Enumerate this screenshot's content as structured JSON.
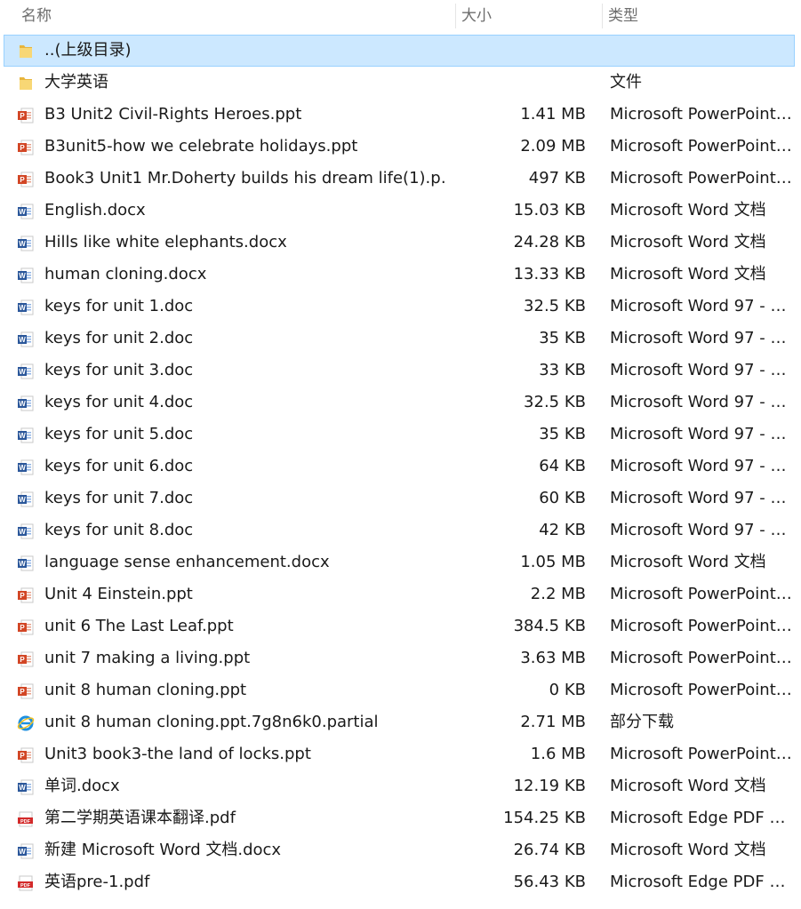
{
  "columns": {
    "name": "名称",
    "size": "大小",
    "type": "类型"
  },
  "colors": {
    "selected_bg": "#cce8ff",
    "selected_border": "#99d1ff",
    "header_text": "#6d6d6d"
  },
  "files": [
    {
      "name": "..(上级目录)",
      "size": "",
      "type": "",
      "icon": "folder-icon",
      "selected": true
    },
    {
      "name": "大学英语",
      "size": "",
      "type": "文件",
      "icon": "folder-icon"
    },
    {
      "name": "B3 Unit2 Civil-Rights Heroes.ppt",
      "size": "1.41 MB",
      "type": "Microsoft PowerPoint…",
      "icon": "ppt-icon"
    },
    {
      "name": "B3unit5-how we celebrate holidays.ppt",
      "size": "2.09 MB",
      "type": "Microsoft PowerPoint…",
      "icon": "ppt-icon"
    },
    {
      "name": "Book3 Unit1 Mr.Doherty builds his dream life(1).p…",
      "size": "497 KB",
      "type": "Microsoft PowerPoint…",
      "icon": "ppt-icon"
    },
    {
      "name": "English.docx",
      "size": "15.03 KB",
      "type": "Microsoft Word 文档",
      "icon": "word-icon"
    },
    {
      "name": "Hills like white elephants.docx",
      "size": "24.28 KB",
      "type": "Microsoft Word 文档",
      "icon": "word-icon"
    },
    {
      "name": "human cloning.docx",
      "size": "13.33 KB",
      "type": "Microsoft Word 文档",
      "icon": "word-icon"
    },
    {
      "name": "keys for unit 1.doc",
      "size": "32.5 KB",
      "type": "Microsoft Word 97 - …",
      "icon": "word-icon"
    },
    {
      "name": "keys for unit 2.doc",
      "size": "35 KB",
      "type": "Microsoft Word 97 - …",
      "icon": "word-icon"
    },
    {
      "name": "keys for unit 3.doc",
      "size": "33 KB",
      "type": "Microsoft Word 97 - …",
      "icon": "word-icon"
    },
    {
      "name": "keys for unit 4.doc",
      "size": "32.5 KB",
      "type": "Microsoft Word 97 - …",
      "icon": "word-icon"
    },
    {
      "name": "keys for unit 5.doc",
      "size": "35 KB",
      "type": "Microsoft Word 97 - …",
      "icon": "word-icon"
    },
    {
      "name": "keys for unit 6.doc",
      "size": "64 KB",
      "type": "Microsoft Word 97 - …",
      "icon": "word-icon"
    },
    {
      "name": "keys for unit 7.doc",
      "size": "60 KB",
      "type": "Microsoft Word 97 - …",
      "icon": "word-icon"
    },
    {
      "name": "keys for unit 8.doc",
      "size": "42 KB",
      "type": "Microsoft Word 97 - …",
      "icon": "word-icon"
    },
    {
      "name": "language sense enhancement.docx",
      "size": "1.05 MB",
      "type": "Microsoft Word 文档",
      "icon": "word-icon"
    },
    {
      "name": "Unit 4 Einstein.ppt",
      "size": "2.2 MB",
      "type": "Microsoft PowerPoint…",
      "icon": "ppt-icon"
    },
    {
      "name": "unit 6 The Last Leaf.ppt",
      "size": "384.5 KB",
      "type": "Microsoft PowerPoint…",
      "icon": "ppt-icon"
    },
    {
      "name": "unit 7 making a living.ppt",
      "size": "3.63 MB",
      "type": "Microsoft PowerPoint…",
      "icon": "ppt-icon"
    },
    {
      "name": "unit 8 human cloning.ppt",
      "size": "0 KB",
      "type": "Microsoft PowerPoint…",
      "icon": "ppt-icon"
    },
    {
      "name": "unit 8 human cloning.ppt.7g8n6k0.partial",
      "size": "2.71 MB",
      "type": "部分下载",
      "icon": "ie-icon"
    },
    {
      "name": "Unit3 book3-the land of locks.ppt",
      "size": "1.6 MB",
      "type": "Microsoft PowerPoint…",
      "icon": "ppt-icon"
    },
    {
      "name": "单词.docx",
      "size": "12.19 KB",
      "type": "Microsoft Word 文档",
      "icon": "word-icon"
    },
    {
      "name": "第二学期英语课本翻译.pdf",
      "size": "154.25 KB",
      "type": "Microsoft Edge PDF …",
      "icon": "pdf-icon",
      "icon_label": "PDF"
    },
    {
      "name": "新建 Microsoft Word 文档.docx",
      "size": "26.74 KB",
      "type": "Microsoft Word 文档",
      "icon": "word-icon"
    },
    {
      "name": "英语pre-1.pdf",
      "size": "56.43 KB",
      "type": "Microsoft Edge PDF …",
      "icon": "pdf-icon",
      "icon_label": "PDF"
    }
  ]
}
